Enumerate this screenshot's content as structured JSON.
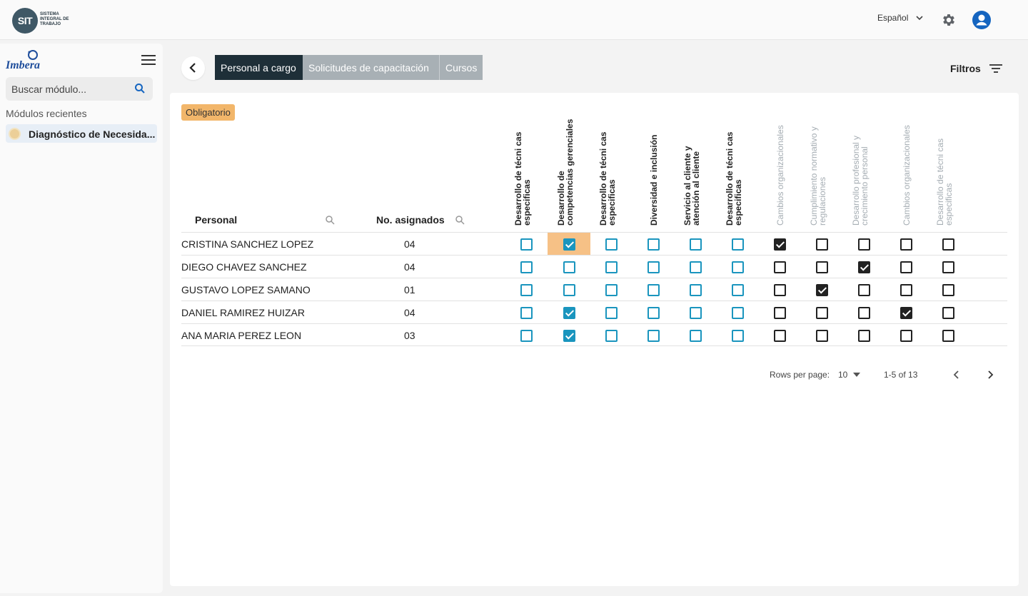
{
  "app": {
    "logo_text": "SIT",
    "logo_subtitle": "SISTEMA INTEGRAL DE TRABAJO",
    "language": "Español",
    "icons": {
      "settings": "gear-icon",
      "user": "account-circle-icon"
    }
  },
  "sidebar": {
    "brand": "Imbera",
    "search_placeholder": "Buscar módulo...",
    "recent_title": "Módulos recientes",
    "recent_items": [
      {
        "label": "Diagnóstico de Necesida..."
      }
    ]
  },
  "tabs": [
    {
      "label": "Personal a cargo",
      "active": true
    },
    {
      "label": "Solicitudes de capacitación",
      "active": false
    },
    {
      "label": "Cursos",
      "active": false
    }
  ],
  "filters_label": "Filtros",
  "badge": "Obligatorio",
  "table": {
    "col_personal": "Personal",
    "col_assigned": "No. asignados",
    "course_columns": [
      {
        "label": "Desarrollo de técni cas especificas",
        "mandatory": true
      },
      {
        "label": "Desarrollo de competencias gerenciales",
        "mandatory": true
      },
      {
        "label": "Desarrollo de técni cas especificas",
        "mandatory": true
      },
      {
        "label": "Diversidad e inclusión",
        "mandatory": true
      },
      {
        "label": "Servicio al cliente y atención al cliente",
        "mandatory": true
      },
      {
        "label": "Desarrollo de técni cas especificas",
        "mandatory": true
      },
      {
        "label": "Cambios organizacionales",
        "mandatory": false
      },
      {
        "label": "Cumplimiento normativo y regulaciones",
        "mandatory": false
      },
      {
        "label": "Desarrollo profesional y crecimiento personal",
        "mandatory": false
      },
      {
        "label": "Cambios organizacionales",
        "mandatory": false
      },
      {
        "label": "Desarrollo de técni cas especificas",
        "mandatory": false
      }
    ],
    "rows": [
      {
        "name": "CRISTINA SANCHEZ LOPEZ",
        "assigned": "04",
        "checks": [
          false,
          true,
          false,
          false,
          false,
          false,
          true,
          false,
          false,
          false,
          false
        ]
      },
      {
        "name": "DIEGO CHAVEZ SANCHEZ",
        "assigned": "04",
        "checks": [
          false,
          false,
          false,
          false,
          false,
          false,
          false,
          false,
          true,
          false,
          false
        ]
      },
      {
        "name": "GUSTAVO LOPEZ SAMANO",
        "assigned": "01",
        "checks": [
          false,
          false,
          false,
          false,
          false,
          false,
          false,
          true,
          false,
          false,
          false
        ]
      },
      {
        "name": "DANIEL RAMIREZ HUIZAR",
        "assigned": "04",
        "checks": [
          false,
          true,
          false,
          false,
          false,
          false,
          false,
          false,
          false,
          true,
          false
        ]
      },
      {
        "name": "ANA MARIA PEREZ LEON",
        "assigned": "03",
        "checks": [
          false,
          true,
          false,
          false,
          false,
          false,
          false,
          false,
          false,
          false,
          false
        ]
      }
    ]
  },
  "pagination": {
    "rows_per_page_label": "Rows per page:",
    "rows_per_page": "10",
    "range": "1-5 of 13"
  },
  "colors": {
    "tab_active": "#1e2f38",
    "tab_inactive": "#a8b0b5",
    "checkbox_mandatory": "#1a95be",
    "checkbox_optional": "#222222",
    "badge": "#f2b66a",
    "highlight": "#f6c186"
  }
}
